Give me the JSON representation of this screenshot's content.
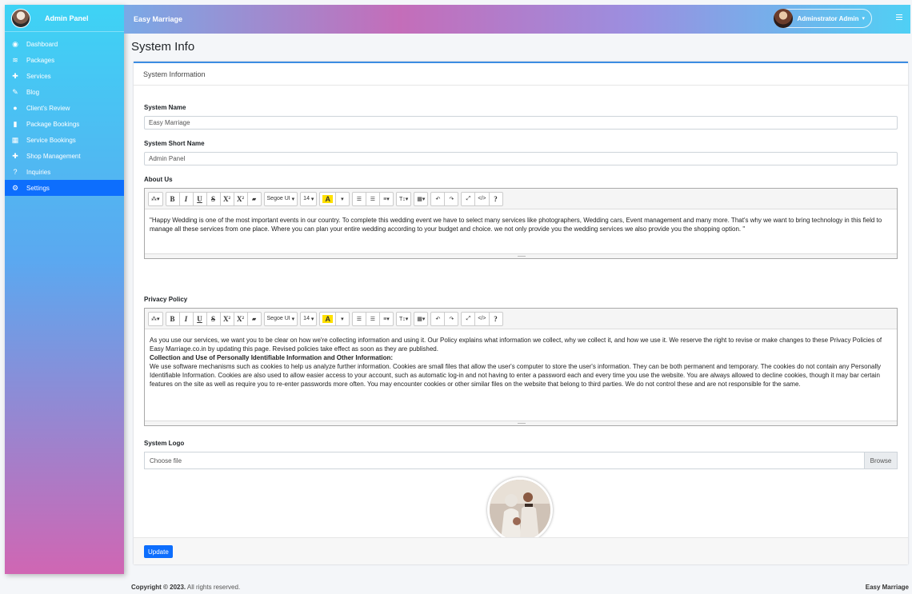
{
  "sidebar": {
    "brand": "Admin Panel",
    "items": [
      {
        "label": "Dashboard",
        "icon": "dashboard-icon"
      },
      {
        "label": "Packages",
        "icon": "layers-icon"
      },
      {
        "label": "Services",
        "icon": "gift-icon"
      },
      {
        "label": "Blog",
        "icon": "blog-icon"
      },
      {
        "label": "Client's Review",
        "icon": "comments-icon"
      },
      {
        "label": "Package Bookings",
        "icon": "file-icon"
      },
      {
        "label": "Service Bookings",
        "icon": "calendar-icon"
      },
      {
        "label": "Shop Management",
        "icon": "gift-icon"
      },
      {
        "label": "Inquiries",
        "icon": "question-icon"
      },
      {
        "label": "Settings",
        "icon": "cogs-icon",
        "active": true
      }
    ]
  },
  "header": {
    "title": "Easy Marriage",
    "user": "Adminstrator Admin"
  },
  "page": {
    "title": "System Info",
    "card_title": "System Information"
  },
  "form": {
    "system_name_label": "System Name",
    "system_name_value": "Easy Marriage",
    "short_name_label": "System Short Name",
    "short_name_value": "Admin Panel",
    "about_label": "About Us",
    "about_text": "\"Happy Wedding is one of the most important events in our country. To complete this wedding event we have to select many services like photographers, Wedding cars, Event management and many more. That's why we want to bring technology in this field to manage all these services from one place. Where you can plan your entire wedding according to your budget and choice. we not only provide you the wedding services we also provide you the shopping option. \"",
    "privacy_label": "Privacy Policy",
    "privacy_p1": "As you use our services, we want you to be clear on how we're collecting information and using it. Our Policy explains what information we collect, why we collect it, and how we use it. We reserve the right to revise or make changes to these Privacy Policies of Easy Marriage.co.in by updating this page. Revised policies take effect as soon as they are published.",
    "privacy_heading": "Collection and Use of Personally Identifiable Information and Other Information:",
    "privacy_p2": "We use software mechanisms such as cookies to help us analyze further information. Cookies are small files that allow the user's computer to store the user's information. They can be both permanent and temporary. The cookies do not contain any Personally Identifiable Information. Cookies are also used to allow easier access to your account, such as automatic log-in and not having to enter a password each and every time you use the website. You are always allowed to decline cookies, though it may bar certain features on the site as well as require you to re-enter passwords more often. You may encounter cookies or other similar files on the website that belong to third parties. We do not control these and are not responsible for the same.",
    "logo_label": "System Logo",
    "file_placeholder": "Choose file",
    "browse_label": "Browse",
    "update_label": "Update"
  },
  "toolbar": {
    "font_name": "Segoe UI",
    "font_size": "14",
    "bold": "B",
    "italic": "I",
    "underline": "U",
    "strike": "S",
    "superscript": "X",
    "subscript": "X",
    "highlight": "A",
    "help": "?"
  },
  "footer": {
    "copyright_bold": "Copyright © 2023.",
    "copyright_rest": "All rights reserved.",
    "brand": "Easy Marriage"
  }
}
